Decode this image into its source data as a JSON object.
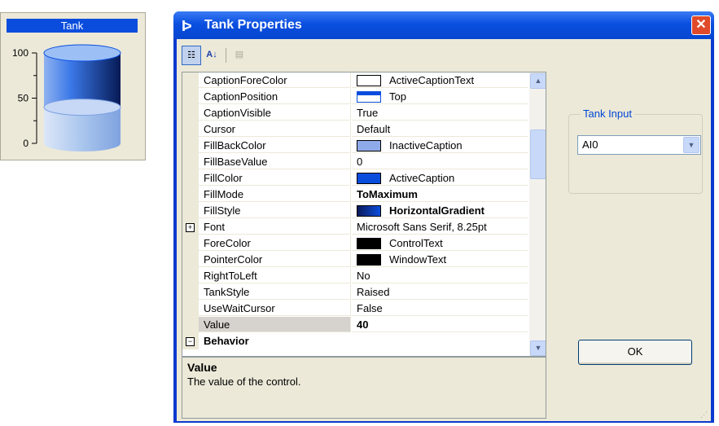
{
  "tank_widget": {
    "caption": "Tank",
    "scale_labels": [
      "100",
      "50",
      "0"
    ],
    "value": 40,
    "max": 100,
    "colors": {
      "caption": "#0a4ddd",
      "fill": "#0a4ddd",
      "back": "#a6c4ee"
    }
  },
  "dialog": {
    "title": "Tank Properties",
    "title_icon": "arrow-logo-icon",
    "close_icon": "close-icon",
    "toolbar": [
      {
        "name": "categorized-icon",
        "glyph": "☷"
      },
      {
        "name": "alphabetical-icon",
        "glyph": "A↓"
      },
      {
        "name": "property-pages-icon",
        "glyph": "▤"
      }
    ],
    "properties": [
      {
        "name": "CaptionForeColor",
        "value": "ActiveCaptionText",
        "swatch": "#ffffff"
      },
      {
        "name": "CaptionPosition",
        "value": "Top",
        "swatch": "caption-top"
      },
      {
        "name": "CaptionVisible",
        "value": "True"
      },
      {
        "name": "Cursor",
        "value": "Default"
      },
      {
        "name": "FillBackColor",
        "value": "InactiveCaption",
        "swatch": "#8eaae8"
      },
      {
        "name": "FillBaseValue",
        "value": "0"
      },
      {
        "name": "FillColor",
        "value": "ActiveCaption",
        "swatch": "#0a4ddd"
      },
      {
        "name": "FillMode",
        "value": "ToMaximum",
        "bold": true
      },
      {
        "name": "FillStyle",
        "value": "HorizontalGradient",
        "bold": true,
        "swatch": "gradient"
      },
      {
        "name": "Font",
        "value": "Microsoft Sans Serif, 8.25pt",
        "expandable": true
      },
      {
        "name": "ForeColor",
        "value": "ControlText",
        "swatch": "#000000"
      },
      {
        "name": "PointerColor",
        "value": "WindowText",
        "swatch": "#000000"
      },
      {
        "name": "RightToLeft",
        "value": "No"
      },
      {
        "name": "TankStyle",
        "value": "Raised"
      },
      {
        "name": "UseWaitCursor",
        "value": "False"
      },
      {
        "name": "Value",
        "value": "40",
        "bold": true,
        "selected": true
      }
    ],
    "category": "Behavior",
    "help": {
      "title": "Value",
      "description": "The value of the control."
    },
    "group_label": "Tank Input",
    "tank_input_value": "AI0",
    "ok_label": "OK"
  }
}
